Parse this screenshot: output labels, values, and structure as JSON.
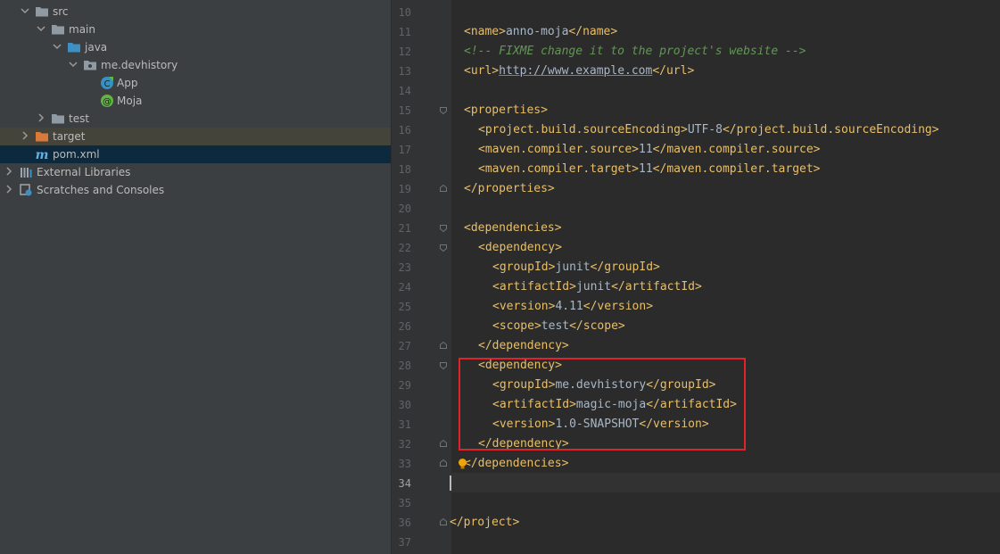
{
  "project_tree": {
    "items": [
      {
        "label": "src",
        "icon": "folder-icon",
        "expanded": true
      },
      {
        "label": "main",
        "icon": "folder-icon",
        "expanded": true
      },
      {
        "label": "java",
        "icon": "source-folder-icon",
        "expanded": true
      },
      {
        "label": "me.devhistory",
        "icon": "package-icon",
        "expanded": true
      },
      {
        "label": "App",
        "icon": "java-class-icon"
      },
      {
        "label": "Moja",
        "icon": "annotation-icon"
      },
      {
        "label": "test",
        "icon": "folder-icon",
        "expanded": false
      },
      {
        "label": "target",
        "icon": "excluded-folder-icon",
        "expanded": false
      },
      {
        "label": "pom.xml",
        "icon": "maven-icon"
      },
      {
        "label": "External Libraries",
        "icon": "library-icon",
        "expanded": false
      },
      {
        "label": "Scratches and Consoles",
        "icon": "scratches-icon",
        "expanded": false
      }
    ]
  },
  "editor": {
    "lines": {
      "n10": "10",
      "n11": "11",
      "n12": "12",
      "n13": "13",
      "n14": "14",
      "n15": "15",
      "n16": "16",
      "n17": "17",
      "n18": "18",
      "n19": "19",
      "n20": "20",
      "n21": "21",
      "n22": "22",
      "n23": "23",
      "n24": "24",
      "n25": "25",
      "n26": "26",
      "n27": "27",
      "n28": "28",
      "n29": "29",
      "n30": "30",
      "n31": "31",
      "n32": "32",
      "n33": "33",
      "n34": "34",
      "n35": "35",
      "n36": "36",
      "n37": "37"
    },
    "code": {
      "name_open": "<name>",
      "name_val": "anno-moja",
      "name_close": "</name>",
      "comment": "<!-- FIXME change it to the project's website -->",
      "url_open": "<url>",
      "url_val": "http://www.example.com",
      "url_close": "</url>",
      "props_open": "<properties>",
      "enc_open": "<project.build.sourceEncoding>",
      "enc_val": "UTF-8",
      "enc_close": "</project.build.sourceEncoding>",
      "src_open": "<maven.compiler.source>",
      "src_val": "11",
      "src_close": "</maven.compiler.source>",
      "tgt_open": "<maven.compiler.target>",
      "tgt_val": "11",
      "tgt_close": "</maven.compiler.target>",
      "props_close": "</properties>",
      "deps_open": "<dependencies>",
      "dep_open": "<dependency>",
      "g_open": "<groupId>",
      "g1_val": "junit",
      "g_close": "</groupId>",
      "a_open": "<artifactId>",
      "a1_val": "junit",
      "a_close": "</artifactId>",
      "v_open": "<version>",
      "v1_val": "4.11",
      "v_close": "</version>",
      "s_open": "<scope>",
      "s1_val": "test",
      "s_close": "</scope>",
      "dep_close": "</dependency>",
      "g2_val": "me.devhistory",
      "a2_val": "magic-moja",
      "v2_val": "1.0-SNAPSHOT",
      "deps_close": "</dependencies>",
      "project_close": "</project>"
    }
  },
  "colors": {
    "tag": "#e8bf6a",
    "text": "#a9b7c6",
    "comment": "#629755",
    "highlight_border": "#e0232a",
    "selection": "#0d293e"
  }
}
